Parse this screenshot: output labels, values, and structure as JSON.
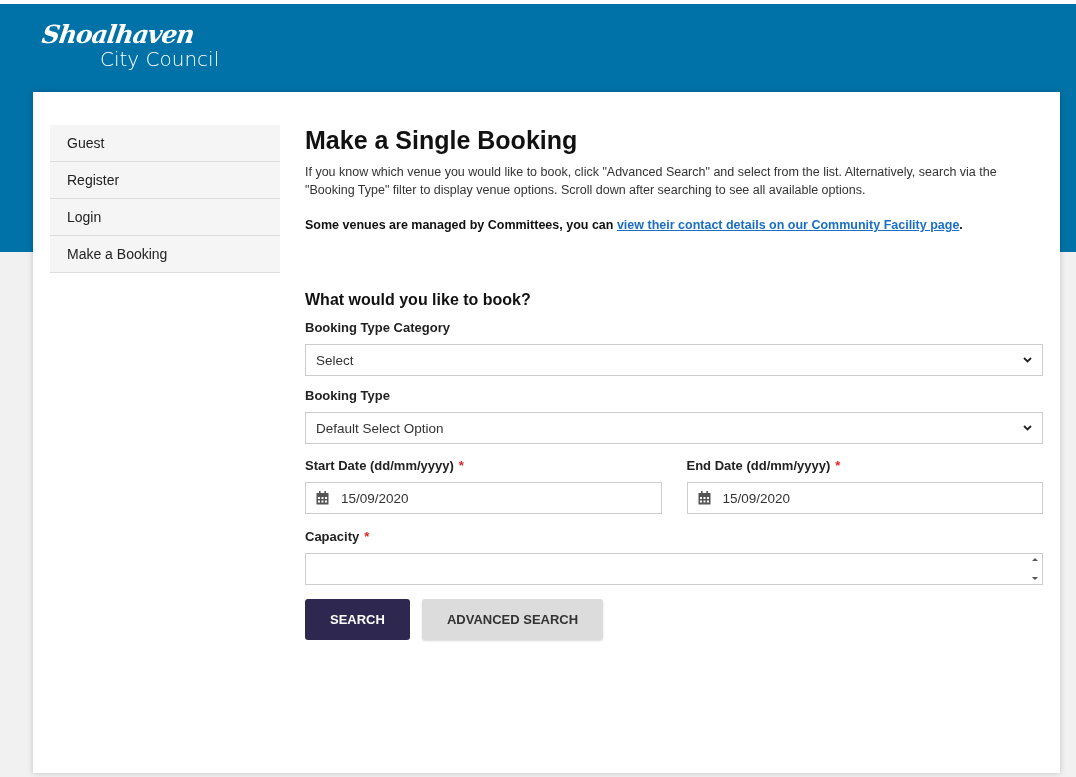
{
  "header": {
    "logo": {
      "name": "Shoalhaven",
      "subtitle": "City Council"
    }
  },
  "sidebar": {
    "items": [
      {
        "label": "Guest"
      },
      {
        "label": "Register"
      },
      {
        "label": "Login"
      },
      {
        "label": "Make a Booking"
      }
    ]
  },
  "main": {
    "title": "Make a Single Booking",
    "intro": "If you know which venue you would like to book, click \"Advanced Search\" and select from the list.  Alternatively, search via the \"Booking Type\" filter to display venue options.  Scroll down after searching to see all available options.",
    "note": {
      "text": "Some venues are managed by Committees, you can ",
      "link": "view their contact details on our Community Facility page",
      "after": "."
    },
    "form_title": "What would you like to book?",
    "fields": [
      {
        "kind": "select",
        "label": "Booking Type Category",
        "value": "Select"
      },
      {
        "kind": "select",
        "label": "Booking Type",
        "value": "Default Select Option"
      },
      {
        "kind": "dates",
        "items": [
          {
            "label": "Start Date (dd/mm/yyyy)",
            "required": "*",
            "value": "15/09/2020"
          },
          {
            "label": "End Date (dd/mm/yyyy)",
            "required": "*",
            "value": "15/09/2020"
          }
        ]
      },
      {
        "kind": "number",
        "label": "Capacity",
        "required": "*"
      }
    ],
    "buttons": [
      {
        "label": "SEARCH",
        "primary": true
      },
      {
        "label": "ADVANCED SEARCH",
        "primary": false
      }
    ]
  }
}
